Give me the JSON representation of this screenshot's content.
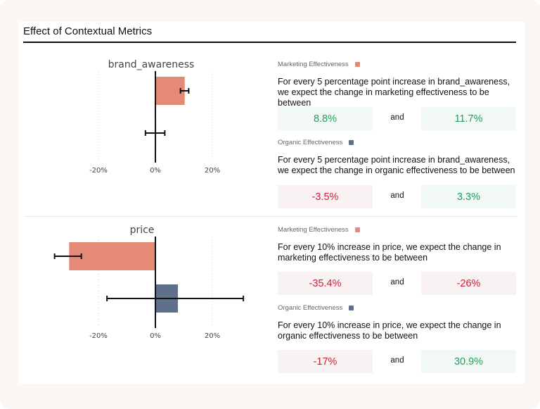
{
  "page": {
    "title": "Effect of Contextual Metrics"
  },
  "colors": {
    "marketing": "#e68a78",
    "organic": "#5f7189",
    "positive_text": "#22a05a",
    "negative_text": "#cc1f3a",
    "positive_bg": "#f2f8f5",
    "negative_bg": "#f9f2f2"
  },
  "chart_data": [
    {
      "type": "bar",
      "orientation": "horizontal",
      "title": "brand_awareness",
      "xlabel": "",
      "ylabel": "",
      "x_ticks": [
        "-20%",
        "0%",
        "20%"
      ],
      "x_tick_values": [
        -20,
        0,
        20
      ],
      "xlim": [
        -30,
        32
      ],
      "grid": true,
      "series": [
        {
          "name": "Marketing Effectiveness",
          "value": 10.3,
          "error_low": 8.8,
          "error_high": 11.7
        },
        {
          "name": "Organic Effectiveness",
          "value": -0.1,
          "error_low": -3.5,
          "error_high": 3.3
        }
      ]
    },
    {
      "type": "bar",
      "orientation": "horizontal",
      "title": "price",
      "xlabel": "",
      "ylabel": "",
      "x_ticks": [
        "-20%",
        "0%",
        "20%"
      ],
      "x_tick_values": [
        -20,
        0,
        20
      ],
      "xlim": [
        -30,
        32
      ],
      "grid": true,
      "series": [
        {
          "name": "Marketing Effectiveness",
          "value": -30.3,
          "error_low": -35.4,
          "error_high": -26
        },
        {
          "name": "Organic Effectiveness",
          "value": 7.9,
          "error_low": -17,
          "error_high": 30.9
        }
      ]
    }
  ],
  "sections": [
    {
      "metric": "brand_awareness",
      "blocks": [
        {
          "legend": "Marketing Effectiveness",
          "description": "For every 5 percentage point increase in brand_awareness, we expect the change in marketing effectiveness to be between",
          "low": "8.8%",
          "low_sign": "pos",
          "and": "and",
          "high": "11.7%",
          "high_sign": "pos"
        },
        {
          "legend": "Organic Effectiveness",
          "description": "For every 5 percentage point increase in brand_awareness, we expect the change in organic effectiveness to be between",
          "low": "-3.5%",
          "low_sign": "neg",
          "and": "and",
          "high": "3.3%",
          "high_sign": "pos"
        }
      ]
    },
    {
      "metric": "price",
      "blocks": [
        {
          "legend": "Marketing Effectiveness",
          "description": "For every 10% increase in price, we expect the change in marketing effectiveness to be between",
          "low": "-35.4%",
          "low_sign": "neg",
          "and": "and",
          "high": "-26%",
          "high_sign": "neg"
        },
        {
          "legend": "Organic Effectiveness",
          "description": "For every 10% increase in price, we expect the change in organic effectiveness to be between",
          "low": "-17%",
          "low_sign": "neg",
          "and": "and",
          "high": "30.9%",
          "high_sign": "pos"
        }
      ]
    }
  ]
}
